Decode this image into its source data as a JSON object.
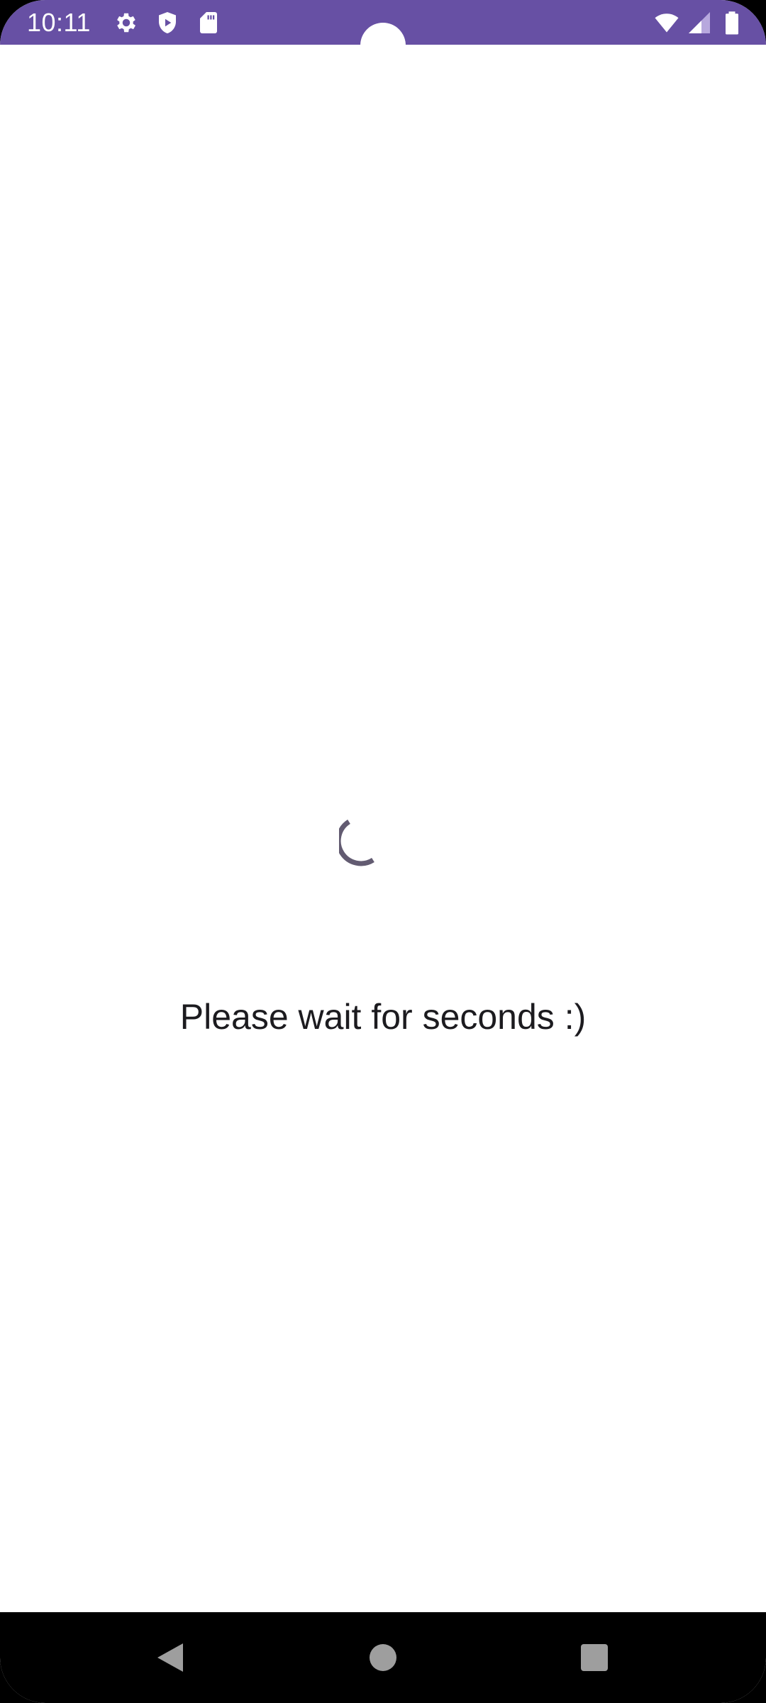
{
  "status_bar": {
    "time": "10:11",
    "background_color": "#6750a4",
    "left_icons": [
      "settings-gear-icon",
      "play-shield-icon",
      "sd-card-icon"
    ],
    "right_icons": [
      "wifi-icon",
      "cell-signal-icon",
      "battery-icon"
    ]
  },
  "loading": {
    "spinner": "progress-spinner",
    "message": "Please wait for seconds :)"
  },
  "navigation_bar": {
    "buttons": [
      "back-icon",
      "home-icon",
      "recents-icon"
    ]
  }
}
